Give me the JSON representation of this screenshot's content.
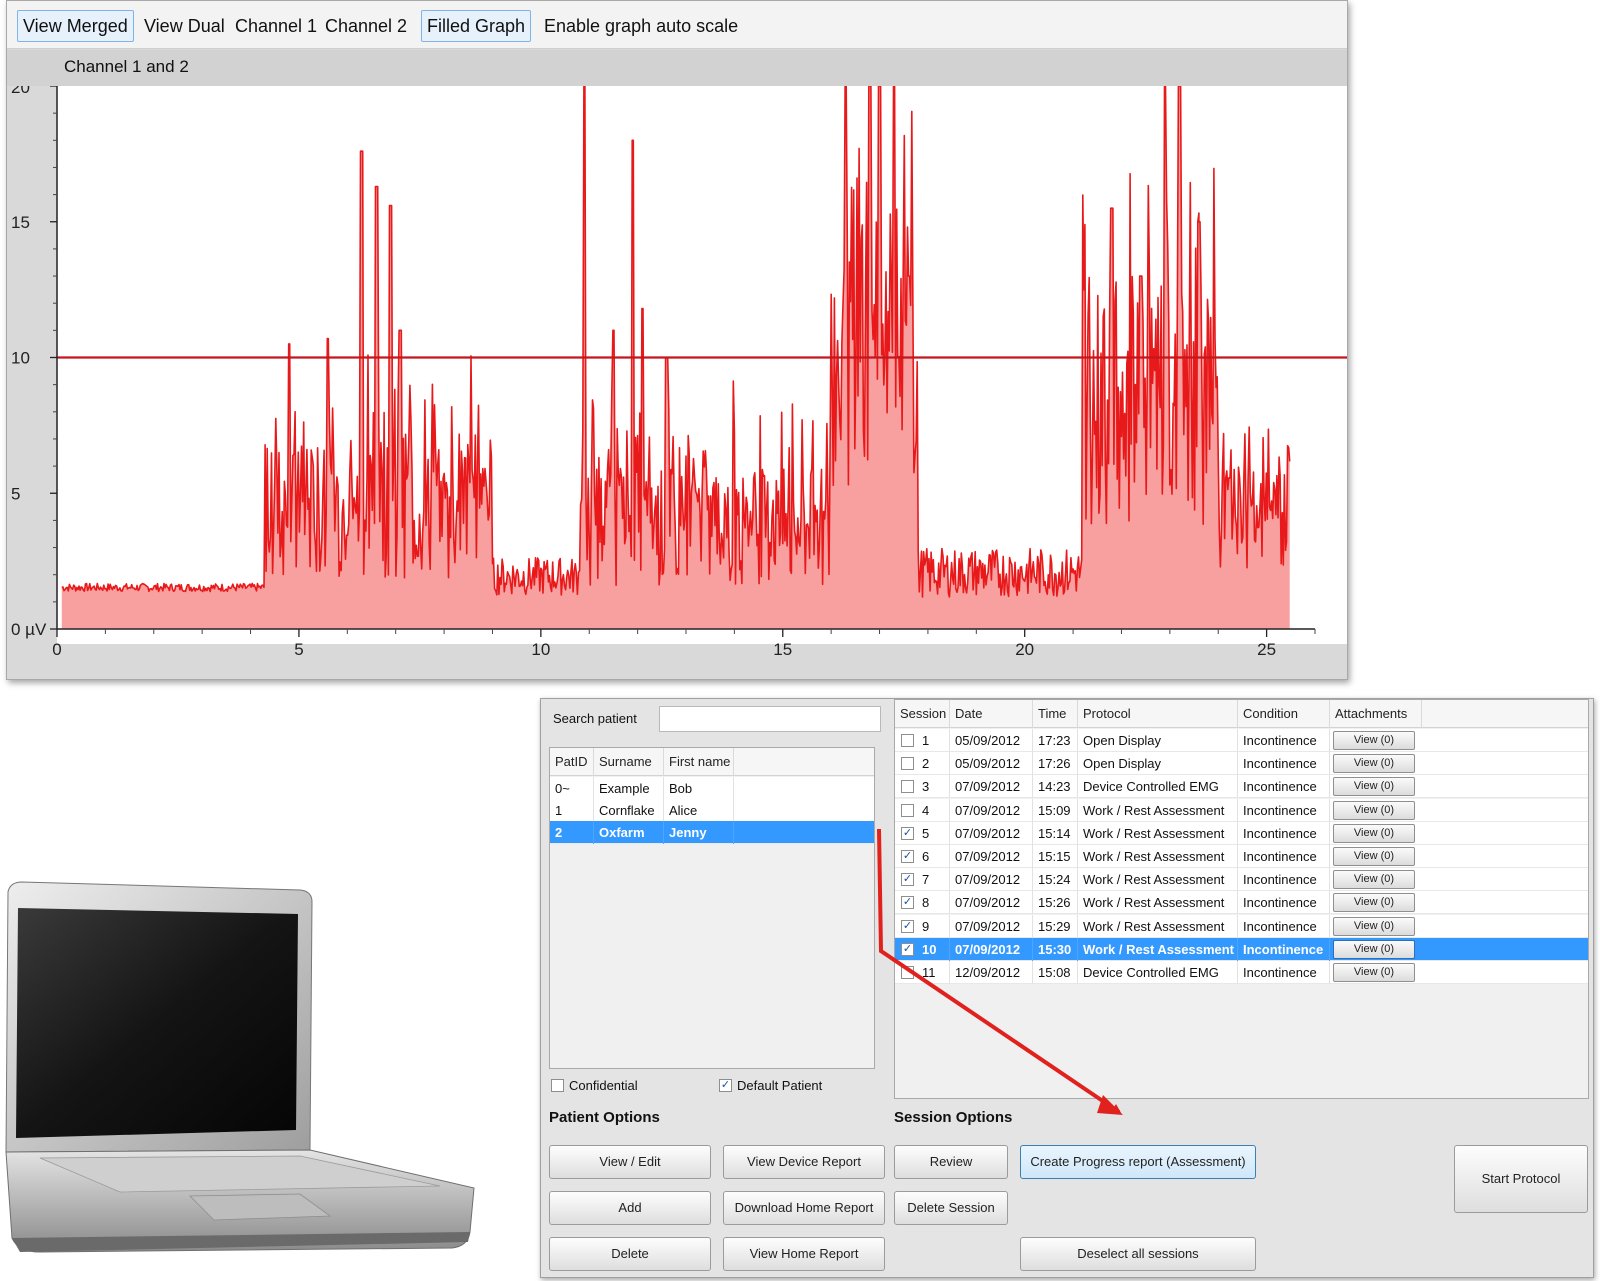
{
  "toolbar": {
    "buttons": [
      {
        "label": "View Merged",
        "active": true
      },
      {
        "label": "View Dual",
        "active": false
      },
      {
        "label": "Channel 1",
        "active": false
      },
      {
        "label": "Channel 2",
        "active": false
      },
      {
        "label": "Filled Graph",
        "active": true
      },
      {
        "label": "Enable graph auto scale",
        "active": false
      }
    ]
  },
  "graph": {
    "header": "Channel 1 and 2"
  },
  "chart_data": {
    "type": "area",
    "series": [
      {
        "color": "#e8191a",
        "fill": "#f8a0a0"
      }
    ],
    "threshold": {
      "value": 10,
      "color": "#c4161c"
    },
    "xlim": [
      0,
      26
    ],
    "ylim": [
      0,
      20
    ],
    "xticks": [
      0,
      5,
      10,
      15,
      20,
      25
    ],
    "yticks": [
      0,
      5,
      10,
      15,
      20
    ],
    "ytick_labels": [
      "0 µV",
      "5",
      "10",
      "15",
      "20"
    ],
    "segments": [
      {
        "x0": 0.1,
        "x1": 4.3,
        "base": 1.5,
        "amp": 0.15,
        "peaks": []
      },
      {
        "x0": 4.3,
        "x1": 9.0,
        "base": 3.8,
        "amp": 2.4,
        "peaks": [
          [
            4.8,
            10.5
          ],
          [
            5.6,
            10.7
          ],
          [
            6.3,
            17.6
          ],
          [
            6.6,
            16.3
          ],
          [
            6.9,
            15.6
          ],
          [
            7.1,
            11.0
          ]
        ]
      },
      {
        "x0": 9.0,
        "x1": 10.8,
        "base": 1.8,
        "amp": 0.7,
        "peaks": []
      },
      {
        "x0": 10.8,
        "x1": 16.0,
        "base": 3.3,
        "amp": 2.2,
        "peaks": [
          [
            10.9,
            20.0
          ],
          [
            11.5,
            11.0
          ],
          [
            11.9,
            18.0
          ],
          [
            12.1,
            11.8
          ],
          [
            12.6,
            10.0
          ]
        ]
      },
      {
        "x0": 16.0,
        "x1": 17.8,
        "base": 8.5,
        "amp": 4.5,
        "peaks": [
          [
            16.3,
            20.0
          ],
          [
            16.8,
            20.0
          ],
          [
            17.0,
            20.0
          ],
          [
            17.3,
            20.0
          ],
          [
            17.6,
            13.0
          ]
        ]
      },
      {
        "x0": 17.8,
        "x1": 21.2,
        "base": 1.9,
        "amp": 0.9,
        "peaks": []
      },
      {
        "x0": 21.2,
        "x1": 24.0,
        "base": 7.2,
        "amp": 4.2,
        "peaks": [
          [
            21.8,
            15.5
          ],
          [
            22.4,
            13.0
          ],
          [
            22.9,
            20.0
          ],
          [
            23.2,
            20.0
          ],
          [
            23.6,
            15.0
          ]
        ]
      },
      {
        "x0": 24.0,
        "x1": 25.5,
        "base": 3.6,
        "amp": 1.9,
        "peaks": []
      }
    ]
  },
  "patients": {
    "search_label": "Search patient",
    "search_value": "",
    "columns": [
      "PatID",
      "Surname",
      "First name"
    ],
    "rows": [
      {
        "id": "0~",
        "surname": "Example",
        "first": "Bob"
      },
      {
        "id": "1",
        "surname": "Cornflake",
        "first": "Alice"
      },
      {
        "id": "2",
        "surname": "Oxfarm",
        "first": "Jenny",
        "selected": true
      }
    ],
    "confidential_label": "Confidential",
    "confidential_checked": false,
    "default_patient_label": "Default Patient",
    "default_patient_checked": true,
    "check_mark": "✓"
  },
  "sessions": {
    "columns": [
      "Session",
      "Date",
      "Time",
      "Protocol",
      "Condition",
      "Attachments"
    ],
    "rows": [
      {
        "checked": false,
        "num": "1",
        "date": "05/09/2012",
        "time": "17:23",
        "protocol": "Open Display",
        "condition": "Incontinence",
        "attach": "View (0)"
      },
      {
        "checked": false,
        "num": "2",
        "date": "05/09/2012",
        "time": "17:26",
        "protocol": "Open Display",
        "condition": "Incontinence",
        "attach": "View (0)"
      },
      {
        "checked": false,
        "num": "3",
        "date": "07/09/2012",
        "time": "14:23",
        "protocol": "Device Controlled EMG",
        "condition": "Incontinence",
        "attach": "View (0)"
      },
      {
        "checked": false,
        "num": "4",
        "date": "07/09/2012",
        "time": "15:09",
        "protocol": "Work / Rest Assessment",
        "condition": "Incontinence",
        "attach": "View (0)"
      },
      {
        "checked": true,
        "num": "5",
        "date": "07/09/2012",
        "time": "15:14",
        "protocol": "Work / Rest Assessment",
        "condition": "Incontinence",
        "attach": "View (0)"
      },
      {
        "checked": true,
        "num": "6",
        "date": "07/09/2012",
        "time": "15:15",
        "protocol": "Work / Rest Assessment",
        "condition": "Incontinence",
        "attach": "View (0)"
      },
      {
        "checked": true,
        "num": "7",
        "date": "07/09/2012",
        "time": "15:24",
        "protocol": "Work / Rest Assessment",
        "condition": "Incontinence",
        "attach": "View (0)"
      },
      {
        "checked": true,
        "num": "8",
        "date": "07/09/2012",
        "time": "15:26",
        "protocol": "Work / Rest Assessment",
        "condition": "Incontinence",
        "attach": "View (0)"
      },
      {
        "checked": true,
        "num": "9",
        "date": "07/09/2012",
        "time": "15:29",
        "protocol": "Work / Rest Assessment",
        "condition": "Incontinence",
        "attach": "View (0)"
      },
      {
        "checked": true,
        "num": "10",
        "date": "07/09/2012",
        "time": "15:30",
        "protocol": "Work / Rest Assessment",
        "condition": "Incontinence",
        "attach": "View (0)",
        "selected": true
      },
      {
        "checked": false,
        "num": "11",
        "date": "12/09/2012",
        "time": "15:08",
        "protocol": "Device Controlled EMG",
        "condition": "Incontinence",
        "attach": "View (0)"
      }
    ]
  },
  "patient_options": {
    "title": "Patient Options",
    "view_edit": "View / Edit",
    "view_device_report": "View Device Report",
    "add": "Add",
    "download_home_report": "Download Home Report",
    "delete": "Delete",
    "view_home_report": "View Home Report"
  },
  "session_options": {
    "title": "Session Options",
    "review": "Review",
    "create_progress_report": "Create Progress report (Assessment)",
    "delete_session": "Delete Session",
    "deselect_all": "Deselect all sessions"
  },
  "start_protocol": "Start Protocol",
  "arrow_color": "#e0211d"
}
